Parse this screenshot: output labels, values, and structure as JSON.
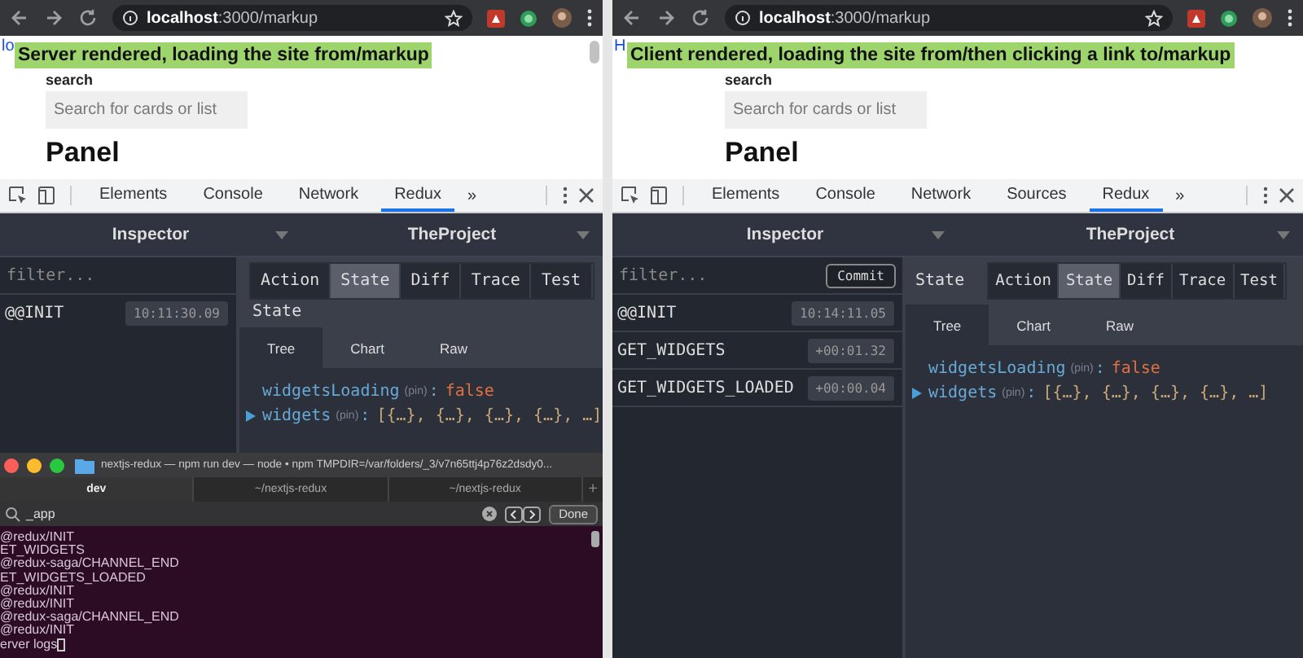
{
  "panes": [
    {
      "kind": "stacked",
      "browser": {
        "host": "localhost",
        "path": ":3000/markup"
      },
      "caption": "Server rendered, loading the site from/markup",
      "page": {
        "link": "lo",
        "search_label": "search",
        "search_placeholder": "Search for cards or list",
        "heading": "Panel"
      },
      "devtools_tabs": [
        {
          "label": "Elements",
          "selected": false
        },
        {
          "label": "Console",
          "selected": false
        },
        {
          "label": "Network",
          "selected": false
        },
        {
          "label": "Redux",
          "selected": true
        }
      ],
      "devtools_more": "»",
      "redux": {
        "monitor": "Inspector",
        "store": "TheProject",
        "filter_placeholder": "filter...",
        "actions": [
          {
            "name": "@@INIT",
            "time": "10:11:30.09"
          }
        ],
        "state_label": "State",
        "inspector_tabs": [
          {
            "label": "Action",
            "selected": false
          },
          {
            "label": "State",
            "selected": true
          },
          {
            "label": "Diff",
            "selected": false
          },
          {
            "label": "Trace",
            "selected": false
          },
          {
            "label": "Test",
            "selected": false
          }
        ],
        "view_tabs": [
          {
            "label": "Tree",
            "selected": true
          },
          {
            "label": "Chart",
            "selected": false
          },
          {
            "label": "Raw",
            "selected": false
          }
        ],
        "tree": [
          {
            "key": "widgetsLoading",
            "pin": "(pin)",
            "separator": ":",
            "value": "false",
            "kind": "boolean",
            "expandable": false
          },
          {
            "key": "widgets",
            "pin": "(pin)",
            "separator": ":",
            "value": "[{…}, {…}, {…}, {…}, …]",
            "kind": "array",
            "expandable": true
          }
        ]
      },
      "terminal": {
        "title": "nextjs-redux — npm run dev — node • npm TMPDIR=/var/folders/_3/v7n65ttj4p76z2dsdy0...",
        "tabs": [
          {
            "label": "dev",
            "selected": true
          },
          {
            "label": "~/nextjs-redux",
            "selected": false
          },
          {
            "label": "~/nextjs-redux",
            "selected": false
          }
        ],
        "new_tab": "+",
        "search_value": "_app",
        "done_button": "Done",
        "lines": [
          "@redux/INIT",
          "ET_WIDGETS",
          "@redux-saga/CHANNEL_END",
          "ET_WIDGETS_LOADED",
          "@redux/INIT",
          "@redux/INIT",
          "@redux-saga/CHANNEL_END",
          "@redux/INIT",
          "erver logs"
        ]
      }
    },
    {
      "kind": "inline",
      "browser": {
        "host": "localhost",
        "path": ":3000/markup"
      },
      "caption": "Client rendered, loading the site from/then clicking a link to/markup",
      "page": {
        "link": "H",
        "search_label": "search",
        "search_placeholder": "Search for cards or list",
        "heading": "Panel"
      },
      "devtools_tabs": [
        {
          "label": "Elements",
          "selected": false
        },
        {
          "label": "Console",
          "selected": false
        },
        {
          "label": "Network",
          "selected": false
        },
        {
          "label": "Sources",
          "selected": false
        },
        {
          "label": "Redux",
          "selected": true
        }
      ],
      "devtools_more": "»",
      "redux": {
        "monitor": "Inspector",
        "store": "TheProject",
        "filter_placeholder": "filter...",
        "commit_button": "Commit",
        "actions": [
          {
            "name": "@@INIT",
            "time": "10:14:11.05"
          },
          {
            "name": "GET_WIDGETS",
            "time": "+00:01.32"
          },
          {
            "name": "GET_WIDGETS_LOADED",
            "time": "+00:00.04"
          }
        ],
        "state_label": "State",
        "inspector_tabs": [
          {
            "label": "Action",
            "selected": false
          },
          {
            "label": "State",
            "selected": true
          },
          {
            "label": "Diff",
            "selected": false
          },
          {
            "label": "Trace",
            "selected": false
          },
          {
            "label": "Test",
            "selected": false
          }
        ],
        "view_tabs": [
          {
            "label": "Tree",
            "selected": true
          },
          {
            "label": "Chart",
            "selected": false
          },
          {
            "label": "Raw",
            "selected": false
          }
        ],
        "tree": [
          {
            "key": "widgetsLoading",
            "pin": "(pin)",
            "separator": ":",
            "value": "false",
            "kind": "boolean",
            "expandable": false
          },
          {
            "key": "widgets",
            "pin": "(pin)",
            "separator": ":",
            "value": "[{…}, {…}, {…}, {…}, …]",
            "kind": "array",
            "expandable": true
          }
        ]
      }
    }
  ]
}
